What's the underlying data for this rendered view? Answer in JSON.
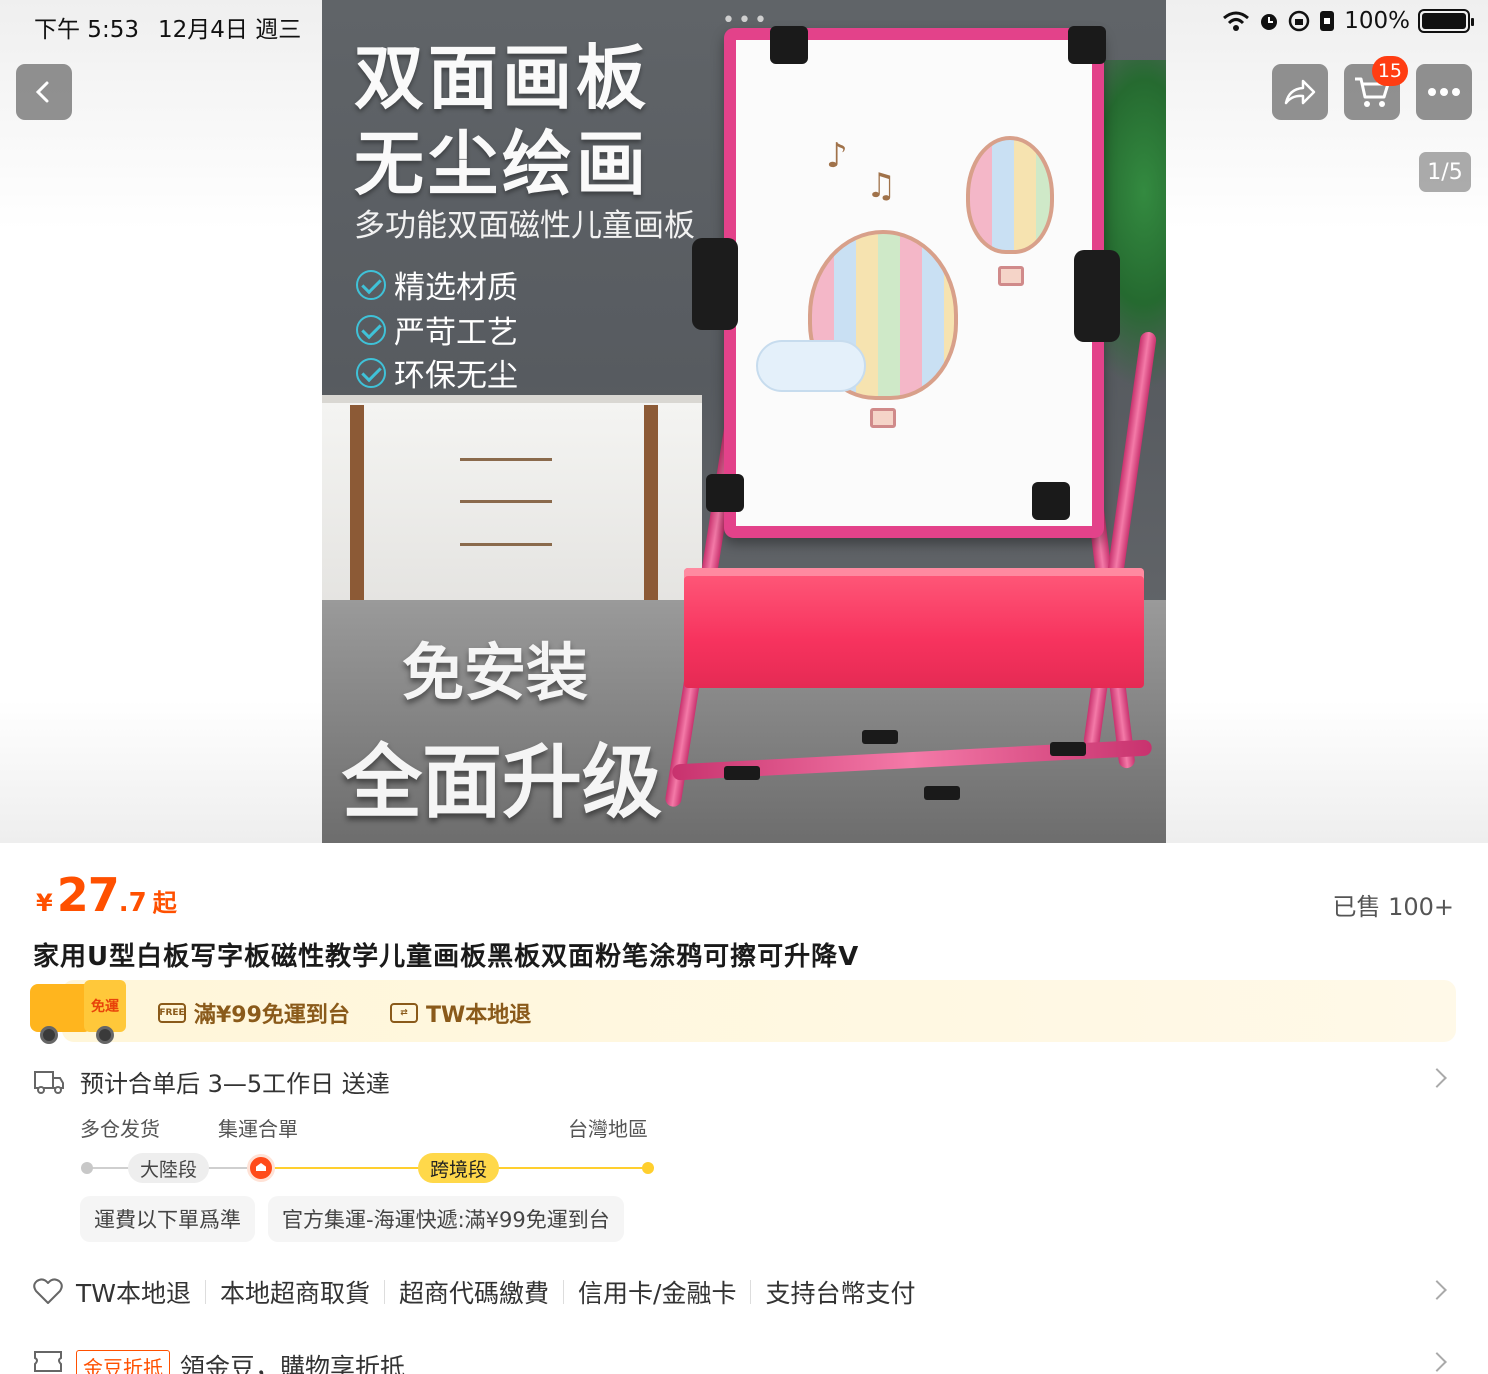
{
  "status_bar": {
    "time": "下午 5:53",
    "date": "12月4日 週三",
    "battery": "100%",
    "battery_level": 1.0
  },
  "top_controls": {
    "back_icon": "chevron-left-icon",
    "share_icon": "share-icon",
    "cart_icon": "cart-icon",
    "cart_badge": "15",
    "more_icon": "more-icon",
    "image_counter": "1/5"
  },
  "hero": {
    "line1": "双面画板",
    "line2": "无尘绘画",
    "subtitle": "多功能双面磁性儿童画板",
    "features": [
      "精选材质",
      "严苛工艺",
      "环保无尘"
    ],
    "bottom1": "免安装",
    "bottom2": "全面升级"
  },
  "product": {
    "currency": "¥",
    "price_int": "27",
    "price_dec": ".7",
    "price_suffix": "起",
    "sold": "已售 100+",
    "title": "家用U型白板写字板磁性教学儿童画板黑板双面粉笔涂鸦可擦可升降V"
  },
  "promo": {
    "truck_label": "免運",
    "free_shipping": "滿¥99免運到台",
    "local_return": "TW本地退"
  },
  "delivery": {
    "estimate": "预计合单后 3—5工作日 送達",
    "stages": [
      "多仓发货",
      "集運合單",
      "台灣地區"
    ],
    "segment_mainland": "大陸段",
    "segment_cross": "跨境段",
    "fee_note": "運費以下單爲準",
    "official_note": "官方集運-海運快遞:滿¥99免運到台"
  },
  "services": [
    "TW本地退",
    "本地超商取貨",
    "超商代碼繳費",
    "信用卡/金融卡",
    "支持台幣支付"
  ],
  "gold_beans": {
    "tag": "金豆折抵",
    "text": "領金豆，購物享折抵"
  },
  "colors": {
    "accent": "#ff5000",
    "promo_bg": "#fff6d9",
    "track_yellow": "#ffcf2e",
    "easel_pink": "#e3428a"
  }
}
